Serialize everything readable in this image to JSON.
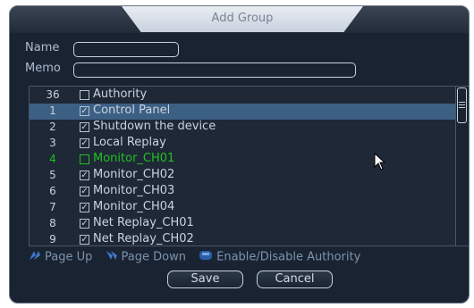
{
  "dialog": {
    "title": "Add Group"
  },
  "form": {
    "name_label": "Name",
    "name_value": "",
    "memo_label": "Memo",
    "memo_value": ""
  },
  "list": {
    "header": {
      "num": "36",
      "label": "Authority",
      "checked": false
    },
    "rows": [
      {
        "num": "1",
        "label": "Control Panel",
        "checked": true,
        "selected": true
      },
      {
        "num": "2",
        "label": "Shutdown the device",
        "checked": true
      },
      {
        "num": "3",
        "label": "Local Replay",
        "checked": true
      },
      {
        "num": "4",
        "label": "Monitor_CH01",
        "checked": false,
        "highlight": true
      },
      {
        "num": "5",
        "label": "Monitor_CH02",
        "checked": true
      },
      {
        "num": "6",
        "label": "Monitor_CH03",
        "checked": true
      },
      {
        "num": "7",
        "label": "Monitor_CH04",
        "checked": true
      },
      {
        "num": "8",
        "label": "Net Replay_CH01",
        "checked": true
      },
      {
        "num": "9",
        "label": "Net Replay_CH02",
        "checked": true
      }
    ]
  },
  "hints": {
    "page_up": "Page Up",
    "page_down": "Page Down",
    "toggle": "Enable/Disable Authority"
  },
  "buttons": {
    "save": "Save",
    "cancel": "Cancel"
  },
  "colors": {
    "highlight_text": "#1fc21f",
    "selected_row": "#3c5f84",
    "dialog_bg": "#1a2331"
  }
}
